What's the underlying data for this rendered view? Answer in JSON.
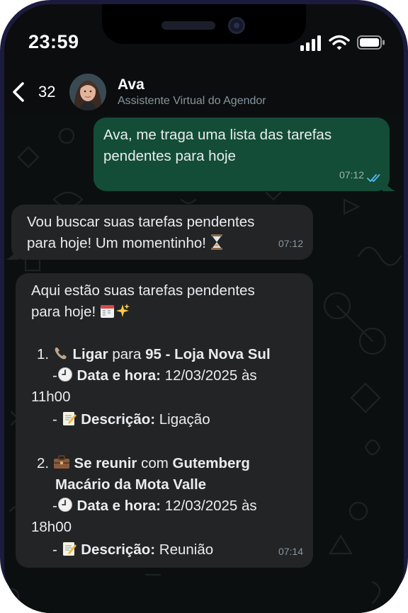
{
  "status_bar": {
    "time": "23:59",
    "icons": [
      "signal-icon",
      "wifi-icon",
      "battery-icon"
    ]
  },
  "header": {
    "back_count": "32",
    "contact_name": "Ava",
    "contact_subtitle": "Assistente Virtual do Agendor"
  },
  "colors": {
    "outgoing_bubble": "#134d37",
    "incoming_bubble": "#222426",
    "read_ticks": "#53bdeb",
    "phone_frame": "#1a1b3d"
  },
  "messages": [
    {
      "direction": "outgoing",
      "lines": [
        "Ava, me traga uma lista das tarefas",
        "pendentes para hoje"
      ],
      "time": "07:12",
      "status": "read"
    },
    {
      "direction": "incoming",
      "lines": [
        "Vou buscar suas tarefas pendentes",
        "para hoje! Um momentinho!"
      ],
      "time": "07:12",
      "emoji": "hourglass-icon"
    },
    {
      "direction": "incoming",
      "intro": [
        "Aqui estão suas tarefas pendentes",
        "para hoje!"
      ],
      "intro_emoji": [
        "calendar-icon",
        "sparkles-icon"
      ],
      "tasks": [
        {
          "number": "1.",
          "icon": "telephone-icon",
          "action": "Ligar",
          "connector": "para",
          "target": "95 - Loja Nova Sul",
          "target_line2": "",
          "date_prefix": "-",
          "date_label": "Data e hora:",
          "date_value": "12/03/2025 às",
          "date_value_line2": "11h00",
          "desc_prefix": "-",
          "desc_label": "Descrição:",
          "desc_value": "Ligação"
        },
        {
          "number": "2.",
          "icon": "briefcase-icon",
          "action": "Se reunir",
          "connector": "com",
          "target": "Gutemberg",
          "target_line2": "Macário da Mota Valle",
          "date_prefix": "-",
          "date_label": "Data e hora:",
          "date_value": "12/03/2025 às",
          "date_value_line2": "18h00",
          "desc_prefix": "-",
          "desc_label": "Descrição:",
          "desc_value": "Reunião"
        }
      ],
      "time": "07:14"
    }
  ]
}
